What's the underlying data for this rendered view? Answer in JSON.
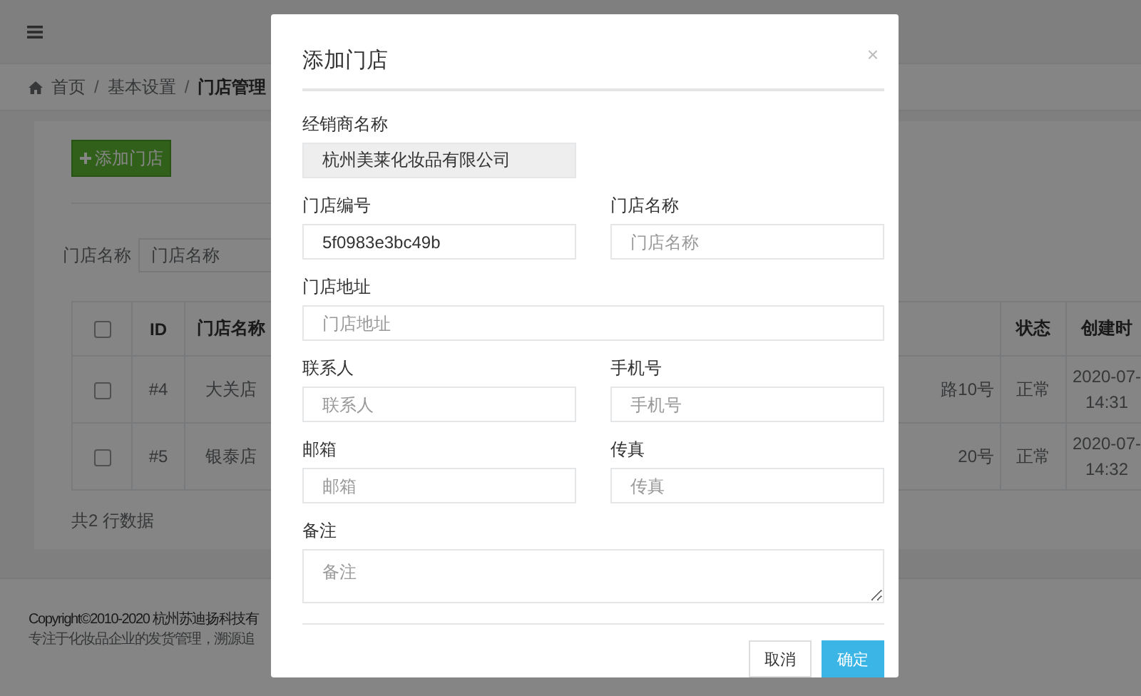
{
  "breadcrumb": [
    {
      "label": "首页",
      "current": false
    },
    {
      "separator": "/",
      "label": "基本设置",
      "current": false
    },
    {
      "separator": "/",
      "label": "门店管理",
      "current": true
    }
  ],
  "add_button": "添加门店",
  "filter": {
    "label": "门店名称",
    "placeholder": "门店名称"
  },
  "table": {
    "select_all": {
      "checked": false
    },
    "columns": [
      {
        "label": "ID",
        "kind": "id"
      },
      {
        "label": "门店名称",
        "kind": "name"
      },
      {
        "kind": "address"
      },
      {
        "label": "状态",
        "kind": "status"
      },
      {
        "label": "创建时",
        "kind": "created"
      }
    ],
    "rows": [
      {
        "checked": false,
        "cells": [
          "#4",
          "大关店",
          "路10号",
          "正常",
          "2020-07-\n14:31"
        ]
      },
      {
        "checked": false,
        "cells": [
          "#5",
          "银泰店",
          "20号",
          "正常",
          "2020-07-\n14:32"
        ]
      }
    ],
    "summary": "共2 行数据"
  },
  "footer": {
    "copyright": "Copyright©2010-2020 杭州苏迪扬科技有",
    "tagline": "专注于化妆品企业的发货管理，溯源追"
  },
  "modal": {
    "title": "添加门店",
    "close": "×",
    "rows": [
      [
        {
          "label": "经销商名称",
          "kind": "readonly",
          "value": "杭州美莱化妆品有限公司"
        }
      ],
      [
        {
          "label": "门店编号",
          "kind": "input",
          "value": "5f0983e3bc49b"
        },
        {
          "label": "门店名称",
          "kind": "input",
          "placeholder": "门店名称"
        }
      ],
      [
        {
          "label": "门店地址",
          "kind": "input",
          "placeholder": "门店地址"
        }
      ],
      [
        {
          "label": "联系人",
          "kind": "input",
          "placeholder": "联系人"
        },
        {
          "label": "手机号",
          "kind": "input",
          "placeholder": "手机号"
        }
      ],
      [
        {
          "label": "邮箱",
          "kind": "input",
          "placeholder": "邮箱"
        },
        {
          "label": "传真",
          "kind": "input",
          "placeholder": "传真"
        }
      ],
      [
        {
          "label": "备注",
          "kind": "textarea",
          "placeholder": "备注"
        }
      ]
    ],
    "buttons": [
      {
        "label": "取消",
        "kind": "default"
      },
      {
        "label": "确定",
        "kind": "primary"
      }
    ]
  }
}
